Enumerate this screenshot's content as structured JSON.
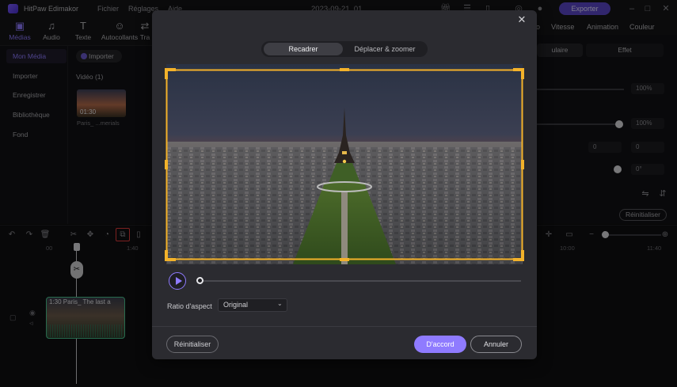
{
  "app": {
    "title": "HitPaw Edimakor",
    "menu": [
      "Fichier",
      "Réglages",
      "Aide"
    ],
    "project_title": "2023-09-21_01",
    "export_label": "Exporter",
    "accent": "#8f7bff"
  },
  "toolbar": {
    "tools": [
      {
        "label": "Médias",
        "icon": "media-icon"
      },
      {
        "label": "Audio",
        "icon": "music-note-icon"
      },
      {
        "label": "Texte",
        "icon": "text-icon"
      },
      {
        "label": "Autocollants",
        "icon": "sticker-icon"
      },
      {
        "label": "Tra",
        "icon": "transition-icon"
      }
    ],
    "right_tabs": [
      "o",
      "Vitesse",
      "Animation",
      "Couleur"
    ]
  },
  "leftnav": {
    "items": [
      "Mon Média",
      "Importer",
      "Enregistrer",
      "Bibliothèque",
      "Fond"
    ]
  },
  "media": {
    "import_label": "Importer",
    "video_section": "Vidéo  (1)",
    "clip_duration": "01:30",
    "clip_name": "Paris_ ...merials"
  },
  "properties": {
    "tab_a": "ulaire",
    "tab_b": "Effet",
    "scale_value": "100%",
    "opacity_value": "100%",
    "pos_x": "0",
    "pos_y": "0",
    "rotation": "0°",
    "reset_label": "Réinitialiser"
  },
  "timeline": {
    "ticks": [
      "00",
      "1:40",
      "10:00",
      "11:40"
    ],
    "clip_label": "1:30  Paris_ The last a"
  },
  "crop_dialog": {
    "tab_crop": "Recadrer",
    "tab_move_zoom": "Déplacer & zoomer",
    "ratio_label": "Ratio d'aspect",
    "ratio_value": "Original",
    "reset_label": "Réinitialiser",
    "ok_label": "D'accord",
    "cancel_label": "Annuler",
    "playback_progress": 0
  }
}
